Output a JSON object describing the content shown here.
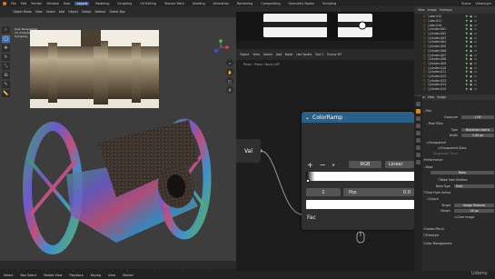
{
  "topbar": {
    "menus": [
      "File",
      "Edit",
      "Render",
      "Window",
      "Help"
    ],
    "workspaces": [
      "Layout",
      "Modeling",
      "Sculpting",
      "UV Editing",
      "Texture Paint",
      "Shading",
      "Animation",
      "Rendering",
      "Compositing",
      "Geometry Nodes",
      "Scripting"
    ],
    "active_workspace": "Layout",
    "scene_label": "Scene",
    "viewlayer_label": "ViewLayer"
  },
  "viewport": {
    "header": [
      "Object Mode",
      "View",
      "Select",
      "Add",
      "Object",
      "Global"
    ],
    "transform_label": "Default",
    "drag_label": "Select Box",
    "stats": [
      "User Perspective",
      "(1) Collection",
      "Sampling"
    ],
    "note": ""
  },
  "node_editor": {
    "toolbar": [
      "Object",
      "View",
      "Select",
      "Add",
      "Node",
      "Use Nodes",
      "Slot 1",
      "Bunny MT"
    ],
    "breadcrumb": [
      "Plane",
      "Plane",
      "Bunny MT"
    ],
    "colorramp": {
      "title": "ColorRamp",
      "mode": "RGB",
      "interpolation": "Linear",
      "index": "1",
      "pos_label": "Pos",
      "pos_value": "0.0",
      "fac_label": "Fac",
      "plus": "+",
      "minus": "−",
      "dropdown": "∨"
    },
    "val_node": "Val"
  },
  "outliner": {
    "header": [
      "View",
      "Image",
      "Overlays"
    ],
    "items": [
      "Cube.012",
      "Cube.011",
      "Cube.010",
      "Cylinder.001",
      "Cylinder.002",
      "Cylinder.003",
      "Cylinder.004",
      "Cylinder.005",
      "Cylinder.006",
      "Cylinder.007",
      "Cylinder.008",
      "Cylinder.009",
      "Cylinder.010",
      "Cylinder.011",
      "Cylinder.012",
      "Cylinder.013",
      "Cylinder.014",
      "Cylinder.015"
    ]
  },
  "properties": {
    "header": [
      "View",
      "View",
      "Image"
    ],
    "sections": {
      "film": "Film",
      "exposure_label": "Exposure",
      "exposure_value": "1.00",
      "pixel_filter": "Pixel Filter",
      "type_label": "Type",
      "type_value": "Blackman-Harris",
      "width_label": "Width",
      "width_value": "1.50 px",
      "transparent": "Transparent",
      "transparent_glass": "Transparent Glass",
      "roughness_label": "Roughness Thres",
      "performance": "Performance",
      "bake": "Bake",
      "bake_button": "Bake",
      "bake_from_multires": "Bake from Multires",
      "bake_type_label": "Bake Type",
      "bake_type_value": "Emit",
      "view_from": "View From Active",
      "output": "Output",
      "target_label": "Target",
      "target_value": "Image Textures",
      "margin_label": "Margin",
      "margin_value": "16 px",
      "clear_image": "Clear Image",
      "grease_pencil": "Grease Pencil",
      "freestyle": "Freestyle",
      "color_management": "Color Management"
    }
  },
  "status": {
    "items": [
      "Select",
      "Box Select",
      "Rotate View",
      "Playback",
      "Keying",
      "View",
      "Marker"
    ],
    "watermark": "Udemy"
  },
  "colors": {
    "accent": "#4772b3",
    "colorramp_header": "#2a6087",
    "object_orange": "#e5994a",
    "active_tab_orange": "#d08a2a"
  }
}
